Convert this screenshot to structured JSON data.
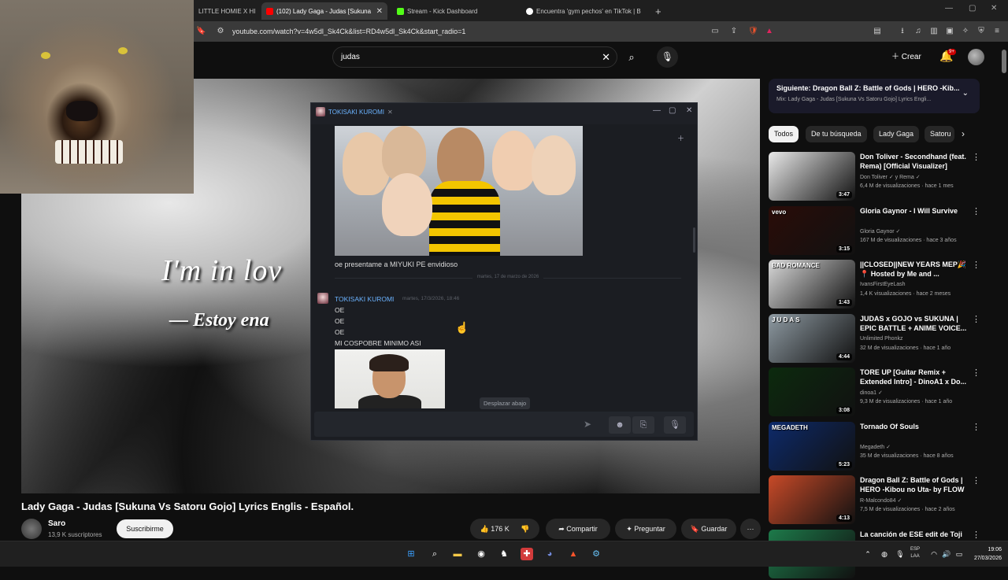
{
  "browser": {
    "tabs": [
      {
        "title": "LITTLE HOMIE X HI",
        "color": "#555"
      },
      {
        "title": "(102) Lady Gaga - Judas [Sukuna",
        "color": "#ff0000"
      },
      {
        "title": "Stream - Kick Dashboard",
        "color": "#53fc18"
      },
      {
        "title": "Encuentra 'gym pechos' en TikTok | B",
        "color": "#ffffff"
      }
    ],
    "new_tab": "+",
    "url": "youtube.com/watch?v=4w5dl_Sk4Ck&list=RD4w5dl_Sk4Ck&start_radio=1"
  },
  "youtube": {
    "search_value": "judas",
    "create_label": "Crear",
    "notif_count": "9+",
    "video": {
      "lyric_1": "I'm in lov",
      "lyric_2": "— Estoy ena",
      "title": "Lady Gaga - Judas [Sukuna Vs Satoru Gojo] Lyrics Englis - Español."
    },
    "channel": {
      "name": "Saro",
      "subs": "13,9 K suscriptores",
      "subscribe_label": "Suscribirme"
    },
    "actions": {
      "likes": "176 K",
      "share": "Compartir",
      "ask": "Preguntar",
      "save": "Guardar",
      "more": "···"
    },
    "next": {
      "title": "Siguiente: Dragon Ball Z: Battle of Gods | HERO -Kib...",
      "subtitle": "Mix: Lady Gaga - Judas [Sukuna Vs Satoru Gojo] Lyrics Engli..."
    },
    "chips": [
      "Todos",
      "De tu búsqueda",
      "Lady Gaga",
      "Satoru"
    ],
    "recommendations": [
      {
        "title": "Don Toliver - Secondhand (feat. Rema) [Official Visualizer]",
        "channel": "Don Toliver ✓ y Rema ✓",
        "meta": "6,4 M de visualizaciones · hace 1 mes",
        "duration": "3:47",
        "thumb": "#e9e9e9"
      },
      {
        "title": "Gloria Gaynor - I Will Survive",
        "channel": "Gloria Gaynor ✓",
        "meta": "167 M de visualizaciones · hace 3 años",
        "duration": "3:15",
        "thumb": "#2a0c08",
        "badge": "vevo"
      },
      {
        "title": "||CLOSED||NEW YEARS MEP🎉 📍 Hosted by Me and ...",
        "channel": "IvansFirstEyeLash",
        "meta": "1,4 K visualizaciones · hace 2 meses",
        "duration": "1:43",
        "thumb": "#d9d9d9",
        "badge": "BAD ROMANCE"
      },
      {
        "title": "JUDAS x GOJO vs SUKUNA | EPIC BATTLE + ANIME VOICE...",
        "channel": "Unlimited Phonkz",
        "meta": "32 M de visualizaciones · hace 1 año",
        "duration": "4:44",
        "thumb": "#8e9aa2",
        "badge": "J U D A S"
      },
      {
        "title": "TORE UP [Guitar Remix + Extended Intro] - DinoA1 x Do...",
        "channel": "dinoa1 ✓",
        "meta": "9,3 M de visualizaciones · hace 1 año",
        "duration": "3:08",
        "thumb": "#0c2a0e"
      },
      {
        "title": "Tornado Of Souls",
        "channel": "Megadeth ✓",
        "meta": "35 M de visualizaciones · hace 8 años",
        "duration": "5:23",
        "thumb": "#0d2a6a",
        "badge": "MEGADETH"
      },
      {
        "title": "Dragon Ball Z: Battle of Gods | HERO -Kibou no Uta- by FLOW ...",
        "channel": "R-Malcondo84 ✓",
        "meta": "7,5 M de visualizaciones · hace 2 años",
        "duration": "4:13",
        "thumb": "#c84a28"
      },
      {
        "title": "La canción de ESE edit de Toji",
        "channel": "",
        "meta": "",
        "duration": "",
        "thumb": "#1d7a4a"
      }
    ]
  },
  "steam_chat": {
    "tab_name": "TOKISAKI KUROMI",
    "caption_1": "oe presentame a MIYUKI PE envidioso",
    "date_separator": "martes, 17 de marzo de 2026",
    "sender": "TOKISAKI KUROMI",
    "time": "martes, 17/3/2026, 18:46",
    "lines": [
      "OE",
      "OE",
      "OE",
      "MI COSPOBRE MINIMO ASI"
    ],
    "scroll_down": "Desplazar abajo"
  },
  "taskbar": {
    "lang": "ESP\nLAA",
    "time": "19:06",
    "date": "27/03/2026"
  }
}
